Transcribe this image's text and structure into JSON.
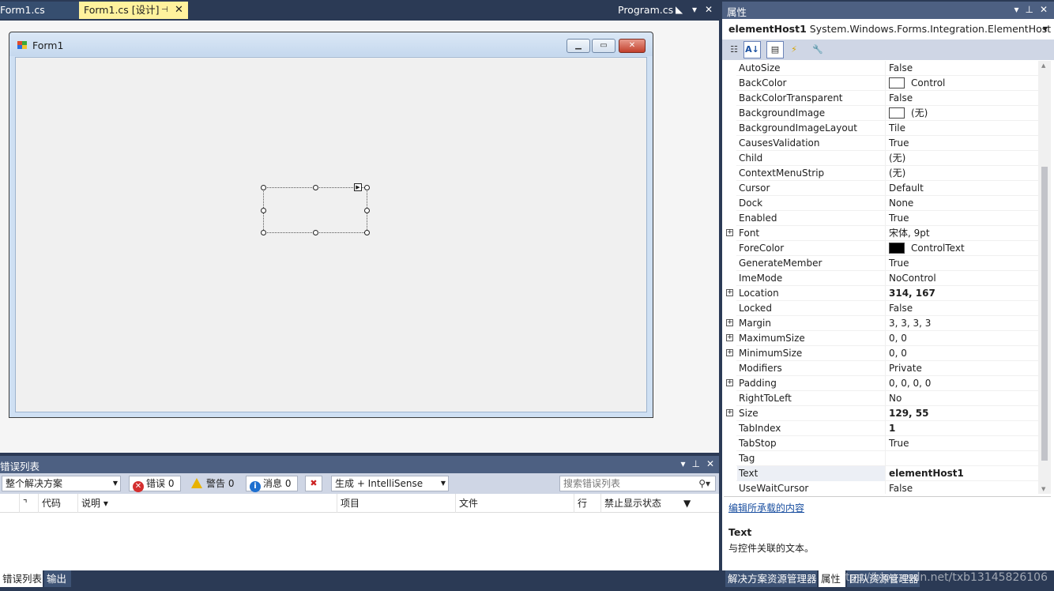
{
  "doc_tabs": {
    "form1_cs": "Form1.cs",
    "form1_design": "Form1.cs [设计]",
    "program_cs": "Program.cs",
    "pin_glyph": "⊣",
    "close_glyph": "✕"
  },
  "form": {
    "title": "Form1",
    "min_glyph": "▁",
    "max_glyph": "▭",
    "close_glyph": "✕"
  },
  "error_list": {
    "title": "错误列表",
    "scope": "整个解决方案",
    "errors_label": "错误 0",
    "warnings_label": "警告 0",
    "messages_label": "消息 0",
    "build_filter": "生成 + IntelliSense",
    "search_placeholder": "搜索错误列表",
    "columns": [
      "代码",
      "说明",
      "项目",
      "文件",
      "行",
      "禁止显示状态"
    ]
  },
  "bottom_tabs_left": [
    "错误列表",
    "输出"
  ],
  "properties": {
    "title": "属性",
    "object_name": "elementHost1",
    "object_type": "System.Windows.Forms.Integration.ElementHost",
    "rows": [
      {
        "name": "AutoSize",
        "value": "False"
      },
      {
        "name": "BackColor",
        "value": "Control",
        "swatch": "#ffffff"
      },
      {
        "name": "BackColorTransparent",
        "value": "False"
      },
      {
        "name": "BackgroundImage",
        "value": "(无)",
        "swatch": "#ffffff"
      },
      {
        "name": "BackgroundImageLayout",
        "value": "Tile"
      },
      {
        "name": "CausesValidation",
        "value": "True"
      },
      {
        "name": "Child",
        "value": "(无)"
      },
      {
        "name": "ContextMenuStrip",
        "value": "(无)"
      },
      {
        "name": "Cursor",
        "value": "Default"
      },
      {
        "name": "Dock",
        "value": "None"
      },
      {
        "name": "Enabled",
        "value": "True"
      },
      {
        "name": "Font",
        "value": "宋体, 9pt",
        "expandable": true
      },
      {
        "name": "ForeColor",
        "value": "ControlText",
        "swatch": "#000000"
      },
      {
        "name": "GenerateMember",
        "value": "True"
      },
      {
        "name": "ImeMode",
        "value": "NoControl"
      },
      {
        "name": "Location",
        "value": "314, 167",
        "expandable": true,
        "bold": true
      },
      {
        "name": "Locked",
        "value": "False"
      },
      {
        "name": "Margin",
        "value": "3, 3, 3, 3",
        "expandable": true
      },
      {
        "name": "MaximumSize",
        "value": "0, 0",
        "expandable": true
      },
      {
        "name": "MinimumSize",
        "value": "0, 0",
        "expandable": true
      },
      {
        "name": "Modifiers",
        "value": "Private"
      },
      {
        "name": "Padding",
        "value": "0, 0, 0, 0",
        "expandable": true
      },
      {
        "name": "RightToLeft",
        "value": "No"
      },
      {
        "name": "Size",
        "value": "129, 55",
        "expandable": true,
        "bold": true
      },
      {
        "name": "TabIndex",
        "value": "1",
        "bold": true
      },
      {
        "name": "TabStop",
        "value": "True"
      },
      {
        "name": "Tag",
        "value": ""
      },
      {
        "name": "Text",
        "value": "elementHost1",
        "bold": true,
        "selected": true
      },
      {
        "name": "UseWaitCursor",
        "value": "False"
      }
    ],
    "command_link": "编辑所承载的内容",
    "description_title": "Text",
    "description_text": "与控件关联的文本。"
  },
  "bottom_tabs_right": [
    "解决方案资源管理器",
    "属性",
    "团队资源管理器"
  ],
  "watermark": "https://blog.csdn.net/txb13145826106"
}
